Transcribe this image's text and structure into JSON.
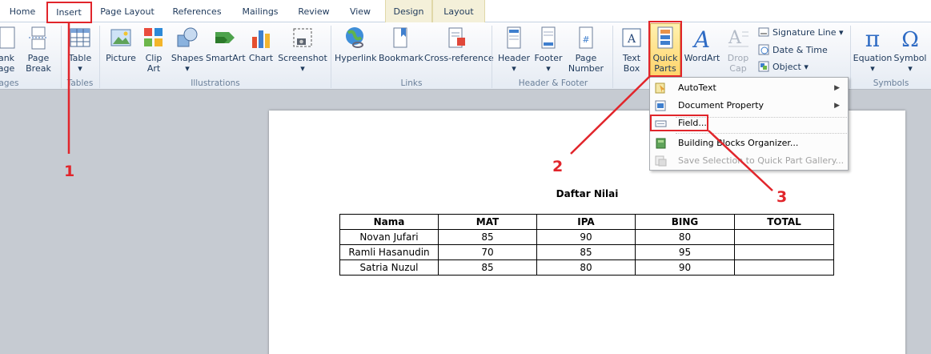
{
  "tabs": [
    {
      "label": "Home"
    },
    {
      "label": "Insert"
    },
    {
      "label": "Page Layout"
    },
    {
      "label": "References"
    },
    {
      "label": "Mailings"
    },
    {
      "label": "Review"
    },
    {
      "label": "View"
    },
    {
      "label": "Design"
    },
    {
      "label": "Layout"
    }
  ],
  "ribbon": {
    "pages": {
      "blank_page_l1": "ank",
      "blank_page_l2": "age",
      "page_break_l1": "Page",
      "page_break_l2": "Break",
      "label": "ages"
    },
    "tables": {
      "table": "Table",
      "label": "Tables"
    },
    "illustrations": {
      "picture": "Picture",
      "clip_art_l1": "Clip",
      "clip_art_l2": "Art",
      "shapes": "Shapes",
      "smartart": "SmartArt",
      "chart": "Chart",
      "screenshot": "Screenshot",
      "label": "Illustrations"
    },
    "links": {
      "hyperlink": "Hyperlink",
      "bookmark": "Bookmark",
      "cross_reference": "Cross-reference",
      "label": "Links"
    },
    "header_footer": {
      "header": "Header",
      "footer": "Footer",
      "page_number_l1": "Page",
      "page_number_l2": "Number",
      "label": "Header & Footer"
    },
    "text": {
      "text_box_l1": "Text",
      "text_box_l2": "Box",
      "quick_parts_l1": "Quick",
      "quick_parts_l2": "Parts",
      "wordart": "WordArt",
      "drop_cap_l1": "Drop",
      "drop_cap_l2": "Cap",
      "signature_line": "Signature Line",
      "date_time": "Date & Time",
      "object": "Object"
    },
    "symbols": {
      "equation": "Equation",
      "symbol": "Symbol",
      "label": "Symbols"
    }
  },
  "menu": {
    "items": [
      {
        "label": "AutoText"
      },
      {
        "label": "Document Property"
      },
      {
        "label": "Field..."
      },
      {
        "label": "Building Blocks Organizer..."
      },
      {
        "label": "Save Selection to Quick Part Gallery..."
      }
    ]
  },
  "document": {
    "title": "Daftar Nilai",
    "headers": [
      "Nama",
      "MAT",
      "IPA",
      "BING",
      "TOTAL"
    ],
    "rows": [
      [
        "Novan Jufari",
        "85",
        "90",
        "80",
        ""
      ],
      [
        "Ramli Hasanudin",
        "70",
        "85",
        "95",
        ""
      ],
      [
        "Satria Nuzul",
        "85",
        "80",
        "90",
        ""
      ]
    ]
  },
  "annotations": {
    "step1": "1",
    "step2": "2",
    "step3": "3",
    "color": "#e1252b"
  }
}
